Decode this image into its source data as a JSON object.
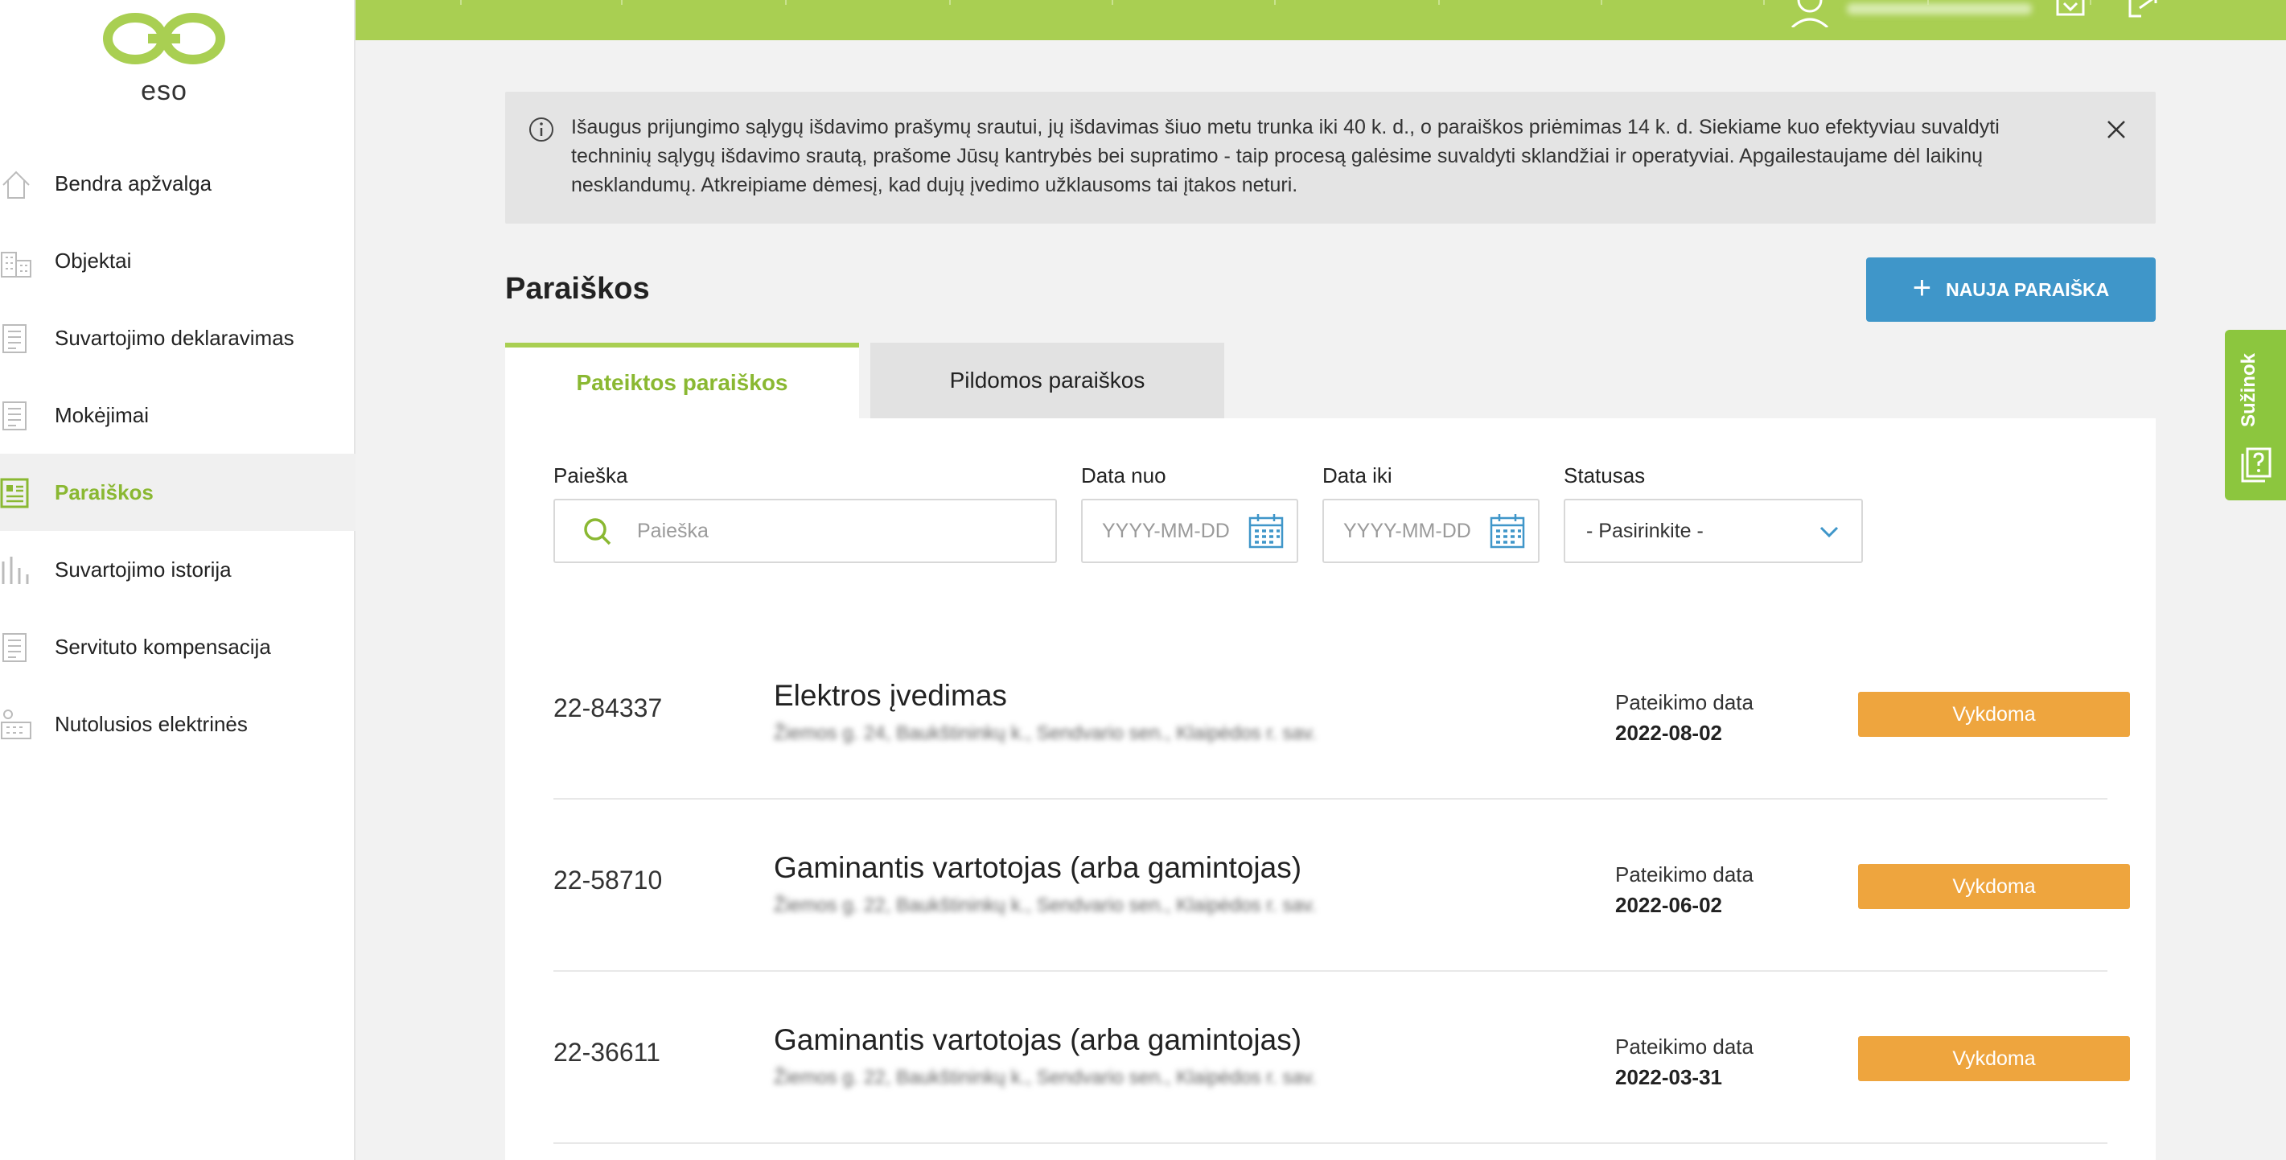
{
  "brand": {
    "logo_text": "eso",
    "primary_green": "#a9cf52",
    "accent_green": "#8ab832",
    "accent_blue": "#3f96c9",
    "status_orange": "#eea53e"
  },
  "sidebar": {
    "items": [
      {
        "label": "Bendra apžvalga",
        "icon": "home-icon"
      },
      {
        "label": "Objektai",
        "icon": "buildings-icon"
      },
      {
        "label": "Suvartojimo deklaravimas",
        "icon": "document-icon"
      },
      {
        "label": "Mokėjimai",
        "icon": "document-icon"
      },
      {
        "label": "Paraiškos",
        "icon": "application-icon",
        "active": true
      },
      {
        "label": "Suvartojimo istorija",
        "icon": "bar-chart-icon"
      },
      {
        "label": "Servituto kompensacija",
        "icon": "document-icon"
      },
      {
        "label": "Nutolusios elektrinės",
        "icon": "power-plant-icon"
      }
    ]
  },
  "banner": {
    "text": "Išaugus prijungimo sąlygų išdavimo prašymų srautui, jų išdavimas šiuo metu trunka iki 40 k. d., o paraiškos priėmimas 14 k. d. Siekiame kuo efektyviau suvaldyti techninių sąlygų išdavimo srautą, prašome Jūsų kantrybės bei supratimo - taip procesą galėsime suvaldyti sklandžiai ir operatyviai. Apgailestaujame dėl laikinų nesklandumų. Atkreipiame dėmesį, kad dujų įvedimo užklausoms tai įtakos neturi."
  },
  "page": {
    "title": "Paraiškos",
    "new_button": "NAUJA PARAIŠKA"
  },
  "tabs": [
    {
      "label": "Pateiktos paraiškos",
      "active": true
    },
    {
      "label": "Pildomos paraiškos",
      "active": false
    }
  ],
  "filters": {
    "search_label": "Paieška",
    "search_placeholder": "Paieška",
    "date_from_label": "Data nuo",
    "date_from_placeholder": "YYYY-MM-DD",
    "date_to_label": "Data iki",
    "date_to_placeholder": "YYYY-MM-DD",
    "status_label": "Statusas",
    "status_value": "- Pasirinkite -"
  },
  "applications": [
    {
      "id": "22-84337",
      "type": "Elektros įvedimas",
      "address": "Žiemos g. 24, Baukštininkų k., Sendvario sen., Klaipėdos r. sav.",
      "date_label": "Pateikimo data",
      "date": "2022-08-02",
      "status": "Vykdoma"
    },
    {
      "id": "22-58710",
      "type": "Gaminantis vartotojas (arba gamintojas)",
      "address": "Žiemos g. 22, Baukštininkų k., Sendvario sen., Klaipėdos r. sav.",
      "date_label": "Pateikimo data",
      "date": "2022-06-02",
      "status": "Vykdoma"
    },
    {
      "id": "22-36611",
      "type": "Gaminantis vartotojas (arba gamintojas)",
      "address": "Žiemos g. 22, Baukštininkų k., Sendvario sen., Klaipėdos r. sav.",
      "date_label": "Pateikimo data",
      "date": "2022-03-31",
      "status": "Vykdoma"
    }
  ],
  "feedback": {
    "label": "Sužinok"
  }
}
